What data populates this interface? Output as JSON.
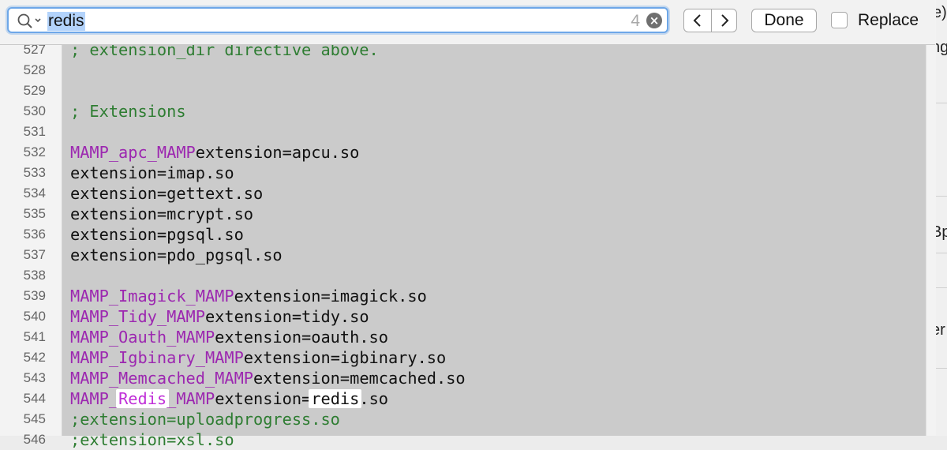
{
  "find_bar": {
    "search_term": "redis",
    "match_count": "4",
    "done_label": "Done",
    "replace_label": "Replace",
    "icons": {
      "search": "magnifier-dropdown-icon",
      "clear": "clear-x-icon",
      "prev": "chevron-left-icon",
      "next": "chevron-right-icon"
    }
  },
  "editor": {
    "lines": [
      {
        "num": "527",
        "text": "; extension_dir directive above."
      },
      {
        "num": "528",
        "text": ""
      },
      {
        "num": "529",
        "text": ""
      },
      {
        "num": "530",
        "text": "; Extensions"
      },
      {
        "num": "531",
        "text": ""
      },
      {
        "num": "532",
        "text": "MAMP_apc_MAMPextension=apcu.so"
      },
      {
        "num": "533",
        "text": "extension=imap.so"
      },
      {
        "num": "534",
        "text": "extension=gettext.so"
      },
      {
        "num": "535",
        "text": "extension=mcrypt.so"
      },
      {
        "num": "536",
        "text": "extension=pgsql.so"
      },
      {
        "num": "537",
        "text": "extension=pdo_pgsql.so"
      },
      {
        "num": "538",
        "text": ""
      },
      {
        "num": "539",
        "text": "MAMP_Imagick_MAMPextension=imagick.so"
      },
      {
        "num": "540",
        "text": "MAMP_Tidy_MAMPextension=tidy.so"
      },
      {
        "num": "541",
        "text": "MAMP_Oauth_MAMPextension=oauth.so"
      },
      {
        "num": "542",
        "text": "MAMP_Igbinary_MAMPextension=igbinary.so"
      },
      {
        "num": "543",
        "text": "MAMP_Memcached_MAMPextension=memcached.so"
      },
      {
        "num": "544",
        "text": "MAMP_Redis_MAMPextension=redis.so"
      },
      {
        "num": "545",
        "text": ";extension=uploadprogress.so"
      },
      {
        "num": "546",
        "text": ";extension=xsl.so"
      }
    ]
  },
  "right_pane": {
    "fragments": [
      "e)",
      "ng",
      "Bp",
      "er"
    ]
  },
  "colors": {
    "comment": "#2e7d32",
    "mamp_marker": "#9c27b0",
    "current_match": "#c030d8",
    "editor_bg": "#cbcbcb",
    "selection": "#b3d3fb"
  }
}
